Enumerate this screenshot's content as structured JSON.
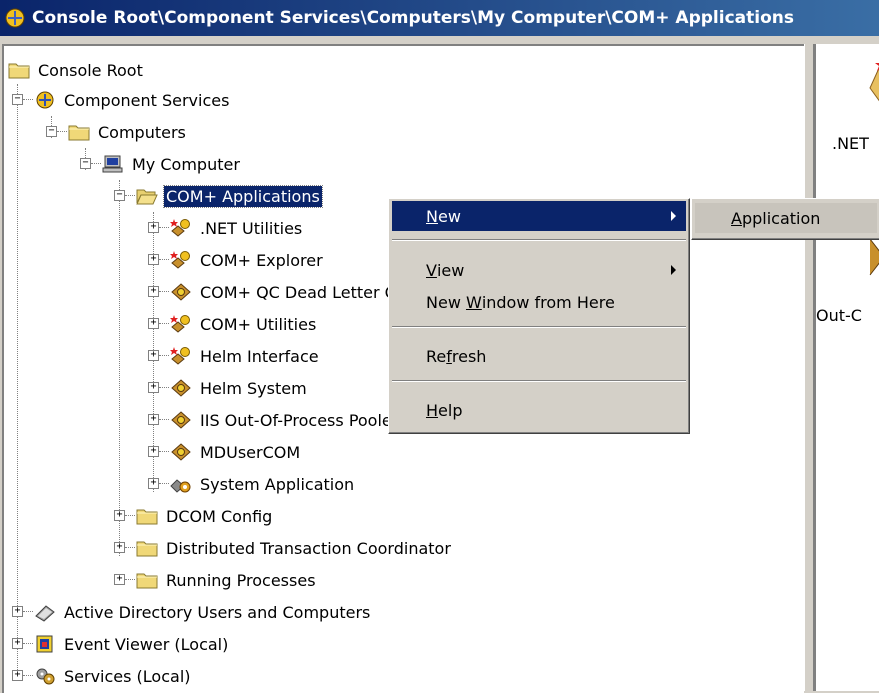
{
  "window": {
    "title": "Console Root\\Component Services\\Computers\\My Computer\\COM+ Applications"
  },
  "tree": {
    "console_root": "Console Root",
    "component_services": "Component Services",
    "computers": "Computers",
    "my_computer": "My Computer",
    "com_apps": "COM+ Applications",
    "apps": [
      ".NET Utilities",
      "COM+ Explorer",
      "COM+ QC Dead Letter Queue Listener",
      "COM+ Utilities",
      "Helm Interface",
      "Helm System",
      "IIS Out-Of-Process Pooled Applications",
      "MDUserCOM",
      "System Application"
    ],
    "dcom": "DCOM Config",
    "dtc": "Distributed Transaction Coordinator",
    "running": "Running Processes",
    "ad": "Active Directory Users and Computers",
    "event_viewer": "Event Viewer (Local)",
    "services": "Services (Local)"
  },
  "right_pane": {
    "label1": ".NET",
    "label2": "Out-C"
  },
  "context_menu": {
    "new": {
      "pre": "",
      "key": "N",
      "post": "ew"
    },
    "view": {
      "pre": "",
      "key": "V",
      "post": "iew"
    },
    "new_window": {
      "pre": "New ",
      "key": "W",
      "post": "indow from Here"
    },
    "refresh": {
      "pre": "Re",
      "key": "f",
      "post": "resh"
    },
    "help": {
      "pre": "",
      "key": "H",
      "post": "elp"
    }
  },
  "submenu": {
    "application": {
      "pre": "",
      "key": "A",
      "post": "pplication"
    }
  }
}
